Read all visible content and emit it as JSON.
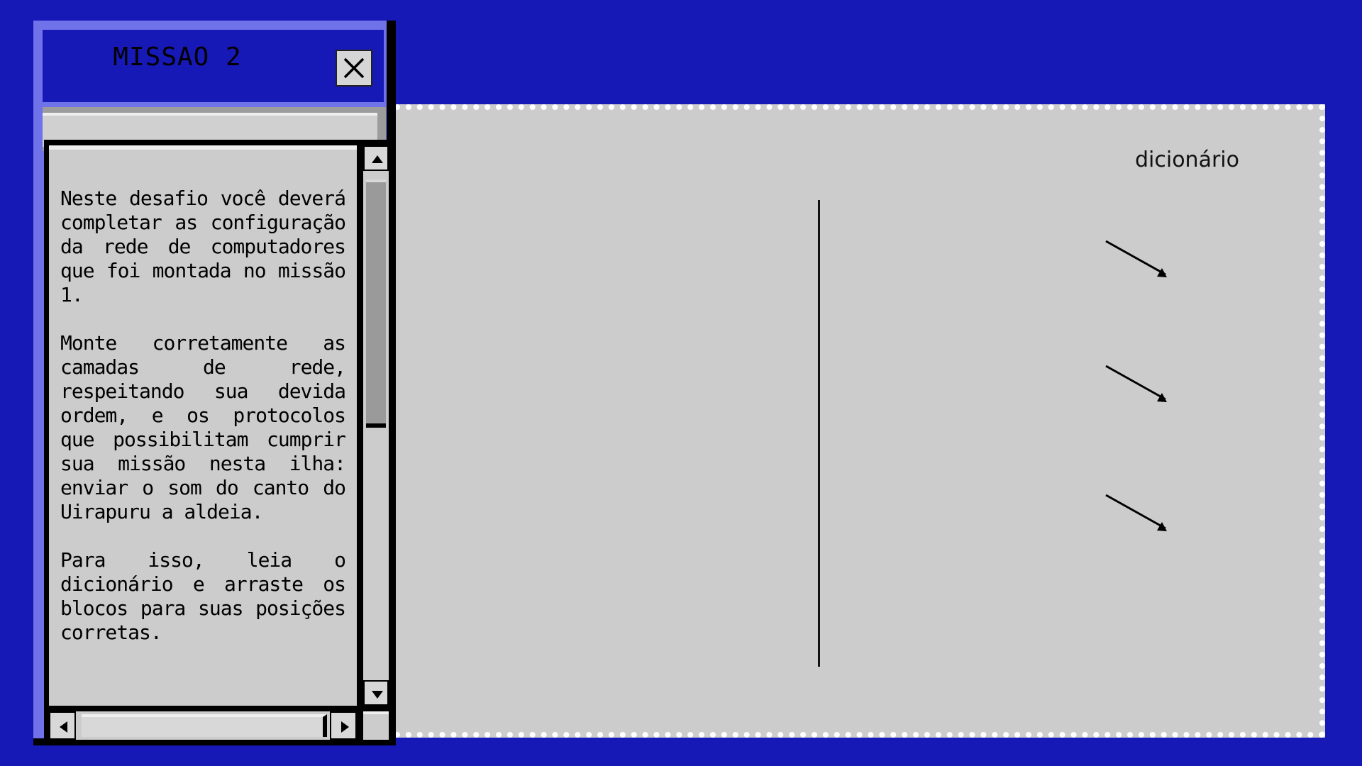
{
  "window": {
    "title": "MISSAO 2",
    "close_icon": "close-icon",
    "paragraphs": [
      "Neste desafio você deverá completar as configuração da rede de computadores que foi montada no missão 1.",
      "Monte corretamente as camadas de rede, respeitando sua devida ordem, e os protocolos que possibilitam cumprir sua missão nesta ilha: enviar o som do canto do Uirapuru a aldeia.",
      "Para isso, leia o dicionário e arraste os blocos para suas posições corretas."
    ]
  },
  "board": {
    "dictionary_label": "dicionário",
    "arrow_icons": [
      "arrow-down-right-icon",
      "arrow-down-right-icon",
      "arrow-down-right-icon"
    ]
  },
  "colors": {
    "background": "#1719b7",
    "board": "#cccccc",
    "window_frame": "#6f72e8"
  }
}
